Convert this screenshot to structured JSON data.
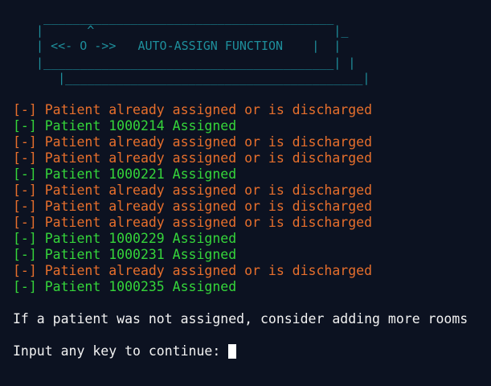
{
  "banner": {
    "line1": "  ________________________________________",
    "line2": " |      ^                                 |_",
    "line3": " | <<- O ->>   AUTO-ASSIGN FUNCTION    |  |",
    "line4": " |________________________________________| |",
    "line5": "    |_________________________________________|"
  },
  "log": [
    {
      "kind": "warn",
      "text": "[-] Patient already assigned or is discharged"
    },
    {
      "kind": "ok",
      "text": "[-] Patient 1000214 Assigned"
    },
    {
      "kind": "warn",
      "text": "[-] Patient already assigned or is discharged"
    },
    {
      "kind": "warn",
      "text": "[-] Patient already assigned or is discharged"
    },
    {
      "kind": "ok",
      "text": "[-] Patient 1000221 Assigned"
    },
    {
      "kind": "warn",
      "text": "[-] Patient already assigned or is discharged"
    },
    {
      "kind": "warn",
      "text": "[-] Patient already assigned or is discharged"
    },
    {
      "kind": "warn",
      "text": "[-] Patient already assigned or is discharged"
    },
    {
      "kind": "ok",
      "text": "[-] Patient 1000229 Assigned"
    },
    {
      "kind": "ok",
      "text": "[-] Patient 1000231 Assigned"
    },
    {
      "kind": "warn",
      "text": "[-] Patient already assigned or is discharged"
    },
    {
      "kind": "ok",
      "text": "[-] Patient 1000235 Assigned"
    }
  ],
  "message": "If a patient was not assigned, consider adding more rooms",
  "prompt": "Input any key to continue: ",
  "colors": {
    "background": "#0c1221",
    "banner": "#1e8f9c",
    "warning": "#e76f2c",
    "success": "#35d53a",
    "text": "#f2f2f2"
  }
}
